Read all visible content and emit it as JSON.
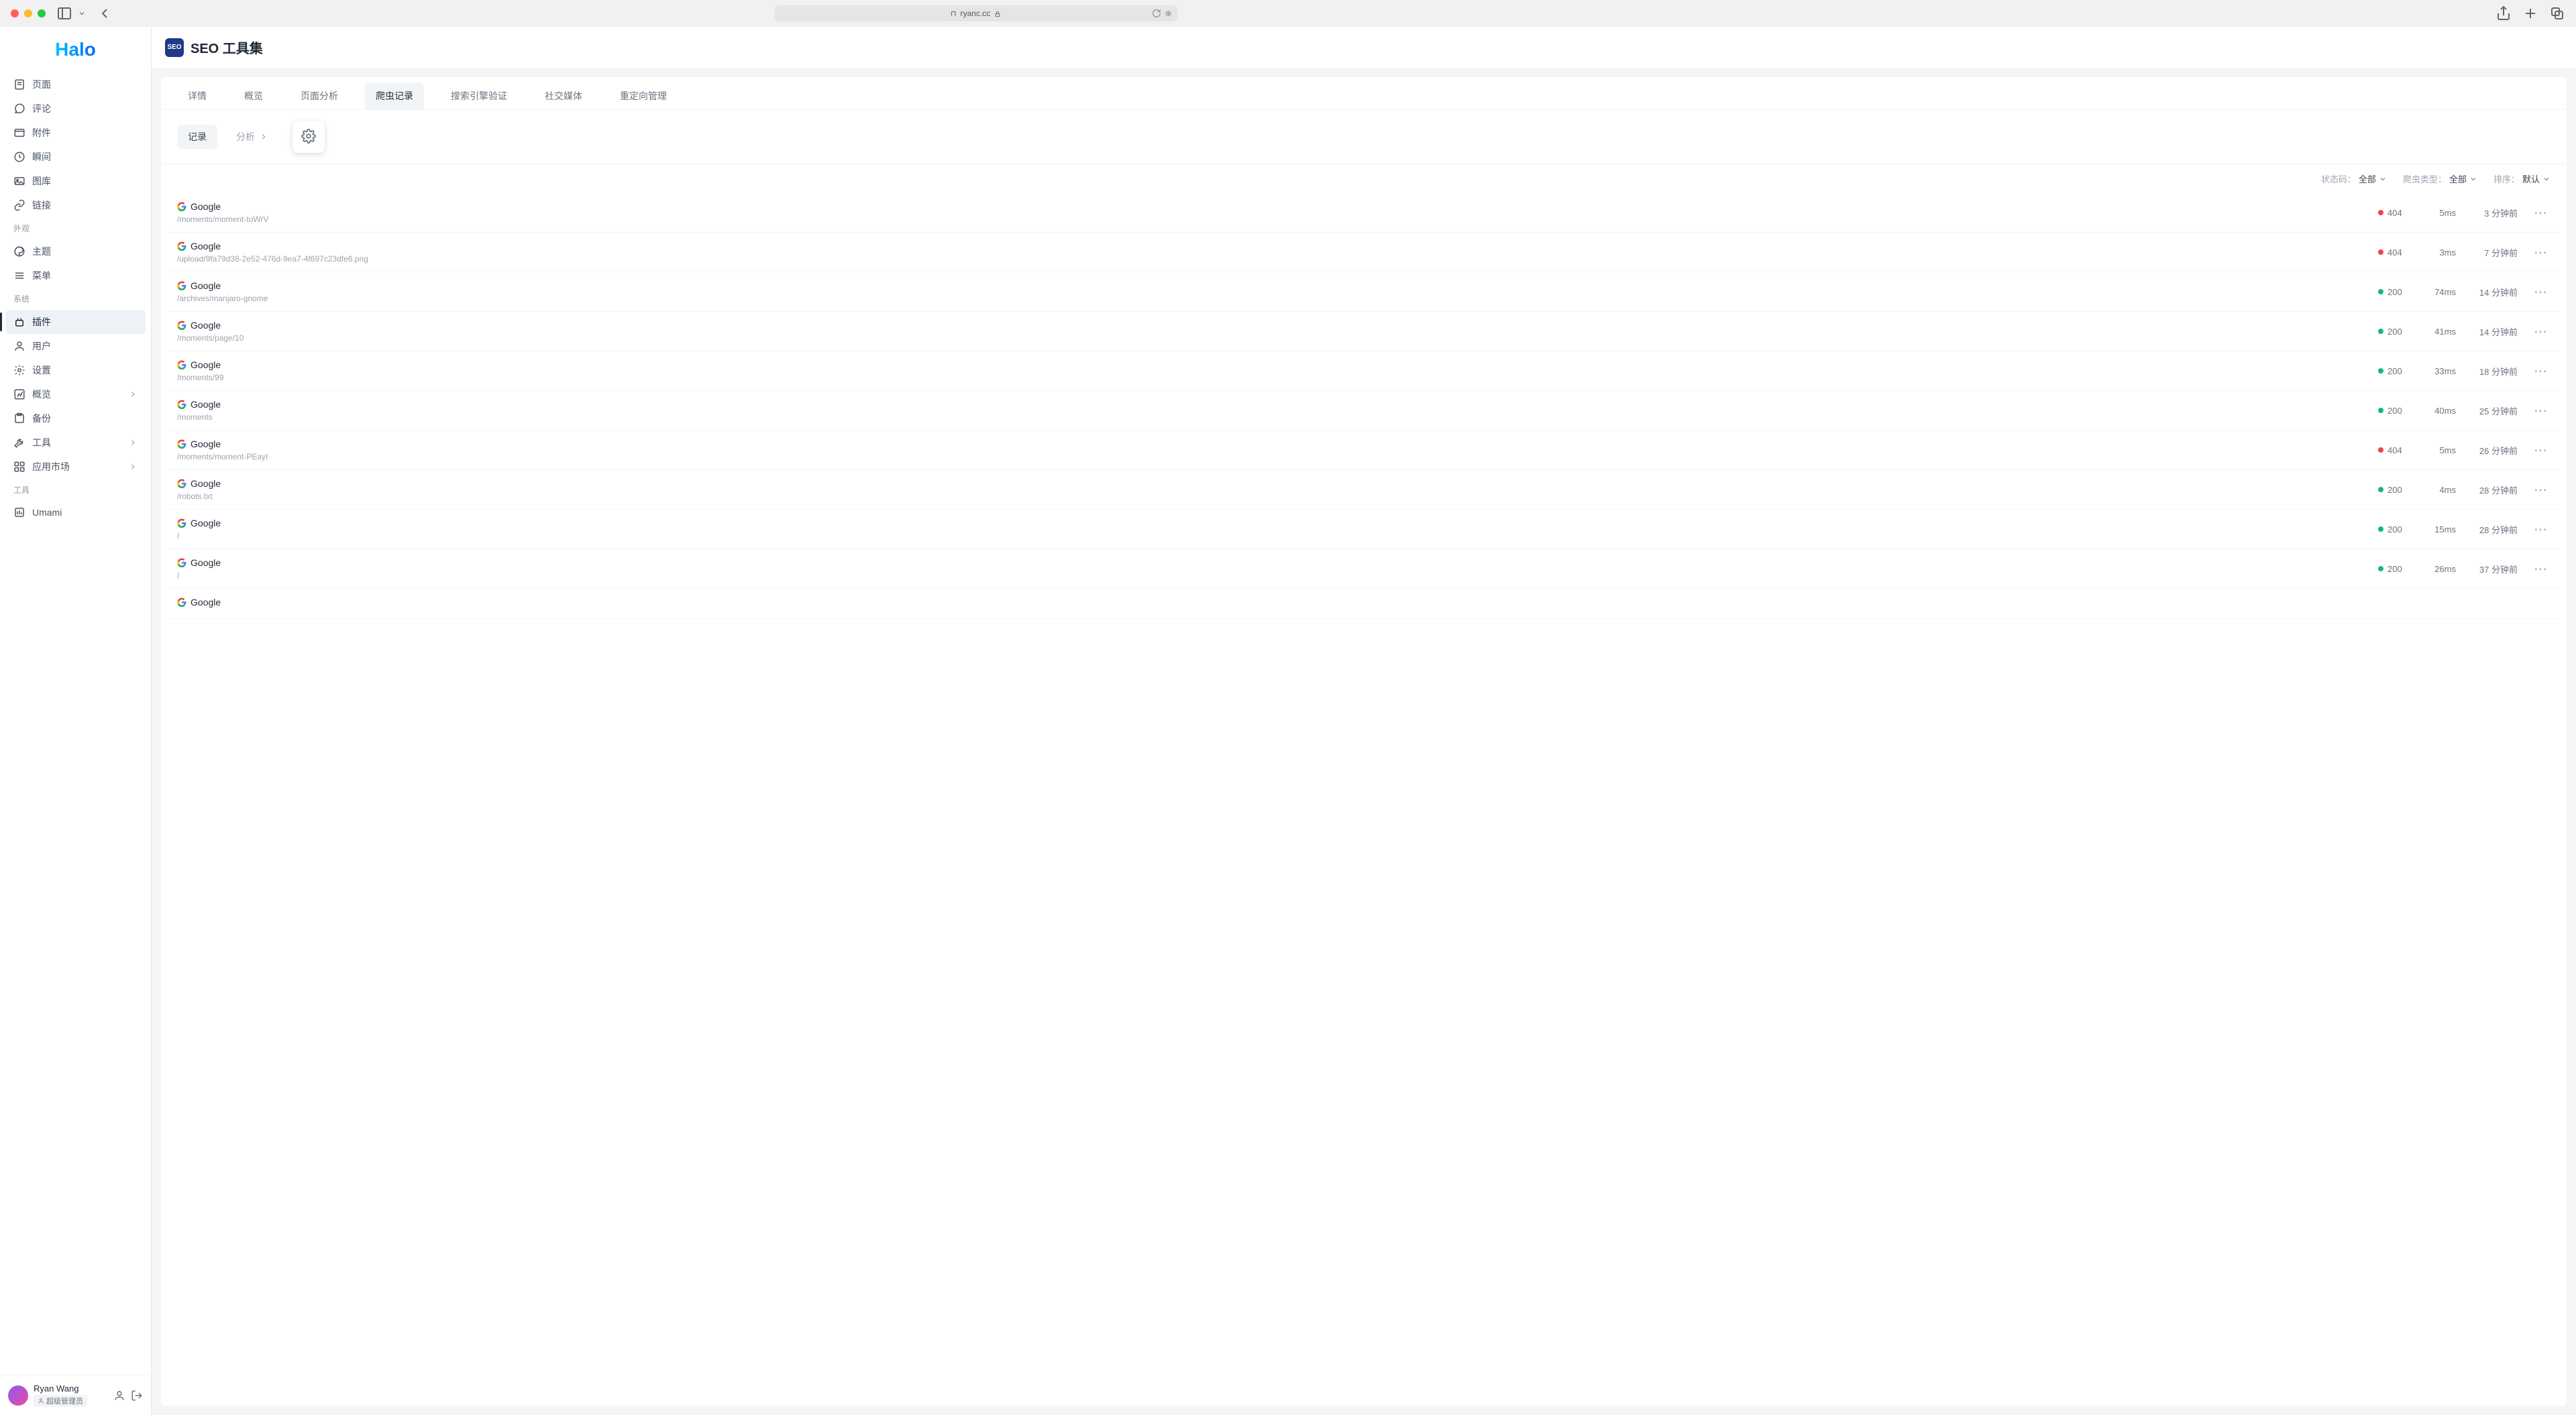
{
  "browser": {
    "url": "ryanc.cc"
  },
  "logo": "Halo",
  "sidebar": {
    "items_main": [
      {
        "label": "页面",
        "icon": "page"
      },
      {
        "label": "评论",
        "icon": "comment"
      },
      {
        "label": "附件",
        "icon": "attachment"
      },
      {
        "label": "瞬间",
        "icon": "moment"
      },
      {
        "label": "图库",
        "icon": "gallery"
      },
      {
        "label": "链接",
        "icon": "link"
      }
    ],
    "section_appearance": "外观",
    "items_appearance": [
      {
        "label": "主题",
        "icon": "theme"
      },
      {
        "label": "菜单",
        "icon": "menu"
      }
    ],
    "section_system": "系统",
    "items_system": [
      {
        "label": "插件",
        "icon": "plugin",
        "active": true
      },
      {
        "label": "用户",
        "icon": "user"
      },
      {
        "label": "设置",
        "icon": "settings"
      },
      {
        "label": "概览",
        "icon": "overview",
        "expandable": true
      },
      {
        "label": "备份",
        "icon": "backup"
      },
      {
        "label": "工具",
        "icon": "tools",
        "expandable": true
      },
      {
        "label": "应用市场",
        "icon": "market",
        "expandable": true
      }
    ],
    "section_tools": "工具",
    "items_tools": [
      {
        "label": "Umami",
        "icon": "umami"
      }
    ]
  },
  "user": {
    "name": "Ryan Wang",
    "role": "超级管理员"
  },
  "page": {
    "icon_text": "SEO",
    "title": "SEO 工具集"
  },
  "tabs": [
    {
      "label": "详情"
    },
    {
      "label": "概览"
    },
    {
      "label": "页面分析"
    },
    {
      "label": "爬虫记录",
      "active": true
    },
    {
      "label": "搜索引擎验证"
    },
    {
      "label": "社交媒体"
    },
    {
      "label": "重定向管理"
    }
  ],
  "toolbar": {
    "record": "记录",
    "analysis": "分析"
  },
  "filters": {
    "status_label": "状态码：",
    "status_value": "全部",
    "crawler_label": "爬虫类型：",
    "crawler_value": "全部",
    "sort_label": "排序：",
    "sort_value": "默认"
  },
  "rows": [
    {
      "crawler": "Google",
      "path": "/moments/moment-toWrV",
      "status": "404",
      "ok": false,
      "ms": "5ms",
      "ago": "3 分钟前"
    },
    {
      "crawler": "Google",
      "path": "/upload/9fa79d38-2e52-476d-9ea7-4f697c23dfe6.png",
      "status": "404",
      "ok": false,
      "ms": "3ms",
      "ago": "7 分钟前"
    },
    {
      "crawler": "Google",
      "path": "/archives/manjaro-gnome",
      "status": "200",
      "ok": true,
      "ms": "74ms",
      "ago": "14 分钟前"
    },
    {
      "crawler": "Google",
      "path": "/moments/page/10",
      "status": "200",
      "ok": true,
      "ms": "41ms",
      "ago": "14 分钟前"
    },
    {
      "crawler": "Google",
      "path": "/moments/99",
      "status": "200",
      "ok": true,
      "ms": "33ms",
      "ago": "18 分钟前"
    },
    {
      "crawler": "Google",
      "path": "/moments",
      "status": "200",
      "ok": true,
      "ms": "40ms",
      "ago": "25 分钟前"
    },
    {
      "crawler": "Google",
      "path": "/moments/moment-PEayI",
      "status": "404",
      "ok": false,
      "ms": "5ms",
      "ago": "26 分钟前"
    },
    {
      "crawler": "Google",
      "path": "/robots.txt",
      "status": "200",
      "ok": true,
      "ms": "4ms",
      "ago": "28 分钟前"
    },
    {
      "crawler": "Google",
      "path": "/",
      "status": "200",
      "ok": true,
      "ms": "15ms",
      "ago": "28 分钟前"
    },
    {
      "crawler": "Google",
      "path": "/",
      "status": "200",
      "ok": true,
      "ms": "26ms",
      "ago": "37 分钟前"
    },
    {
      "crawler": "Google",
      "path": "",
      "status": "",
      "ok": true,
      "ms": "",
      "ago": ""
    }
  ]
}
